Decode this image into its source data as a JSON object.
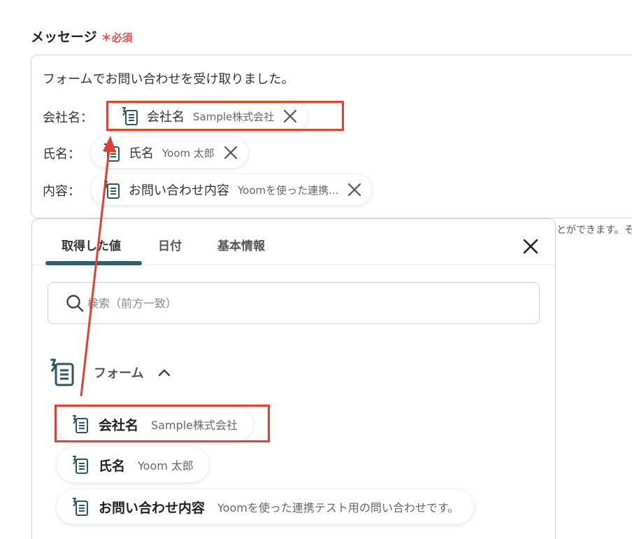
{
  "field": {
    "label": "メッセージ",
    "required": "＊必須"
  },
  "editor": {
    "intro": "フォームでお問い合わせを受け取りました。",
    "rows": [
      {
        "label": "会社名：",
        "chip_name": "会社名",
        "chip_value": "Sample株式会社"
      },
      {
        "label": "氏名：",
        "chip_name": "氏名",
        "chip_value": "Yoom 太郎"
      },
      {
        "label": "内容：",
        "chip_name": "お問い合わせ内容",
        "chip_value": "Yoomを使った連携..."
      }
    ]
  },
  "side_text": "とができます。そ",
  "panel": {
    "tabs": [
      {
        "label": "取得した値",
        "active": true
      },
      {
        "label": "日付",
        "active": false
      },
      {
        "label": "基本情報",
        "active": false
      }
    ],
    "search_placeholder": "検索（前方一致）",
    "section_title": "フォーム",
    "items": [
      {
        "name": "会社名",
        "value": "Sample株式会社"
      },
      {
        "name": "氏名",
        "value": "Yoom 太郎"
      },
      {
        "name": "お問い合わせ内容",
        "value": "Yoomを使った連携テスト用の問い合わせです。"
      }
    ]
  },
  "colors": {
    "accent": "#315e6e",
    "highlight": "#e0402f",
    "required": "#e2504a"
  },
  "icons": {
    "field_icon": "form-field-icon",
    "remove": "close-icon",
    "search": "search-icon",
    "collapse": "chevron-up-icon"
  }
}
